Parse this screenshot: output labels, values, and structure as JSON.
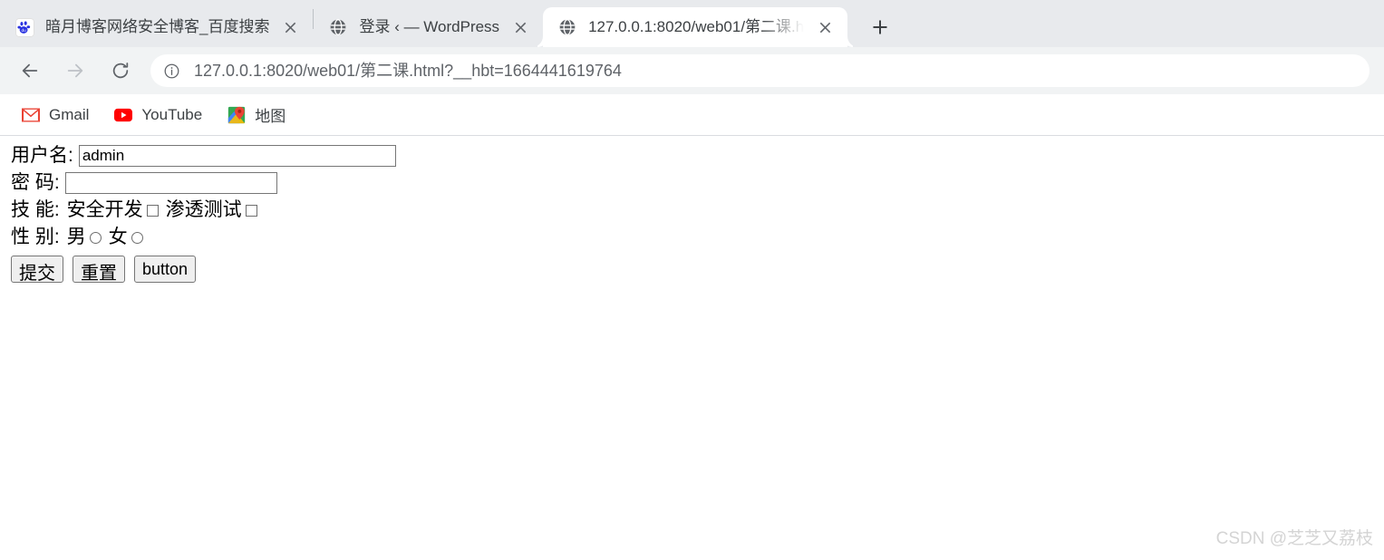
{
  "browser": {
    "tabs": [
      {
        "title": "暗月博客网络安全博客_百度搜索",
        "favicon": "baidu-icon",
        "active": false,
        "close_label": "×"
      },
      {
        "title": "登录 ‹ — WordPress",
        "favicon": "globe-icon",
        "active": false,
        "close_label": "×"
      },
      {
        "title": "127.0.0.1:8020/web01/第二课.h",
        "favicon": "globe-icon",
        "active": true,
        "close_label": "×"
      }
    ],
    "newtab_label": "+",
    "toolbar": {
      "back_icon": "back-arrow-icon",
      "forward_icon": "forward-arrow-icon",
      "reload_icon": "reload-icon",
      "security_icon": "info-circle-icon",
      "url": "127.0.0.1:8020/web01/第二课.html?__hbt=1664441619764"
    },
    "bookmarks": [
      {
        "label": "Gmail",
        "icon": "gmail-icon"
      },
      {
        "label": "YouTube",
        "icon": "youtube-icon"
      },
      {
        "label": "地图",
        "icon": "google-maps-icon"
      }
    ]
  },
  "form": {
    "username": {
      "label": "用户名:",
      "value": "admin",
      "placeholder": ""
    },
    "password": {
      "label": "密 码:",
      "value": "",
      "placeholder": ""
    },
    "skills": {
      "label": "技 能:",
      "options": [
        {
          "label": "安全开发",
          "checked": false
        },
        {
          "label": "渗透测试",
          "checked": false
        }
      ]
    },
    "gender": {
      "label": "性 别:",
      "options": [
        {
          "label": "男",
          "checked": false
        },
        {
          "label": "女",
          "checked": false
        }
      ]
    },
    "buttons": [
      {
        "label": "提交",
        "type": "submit"
      },
      {
        "label": "重置",
        "type": "reset"
      },
      {
        "label": "button",
        "type": "button"
      }
    ]
  },
  "watermark": "CSDN @芝芝又荔枝",
  "colors": {
    "tabstrip_bg": "#e8eaed",
    "toolbar_bg": "#f1f3f4",
    "page_bg": "#ffffff",
    "text": "#3c4043",
    "url_text": "#5f6368"
  }
}
